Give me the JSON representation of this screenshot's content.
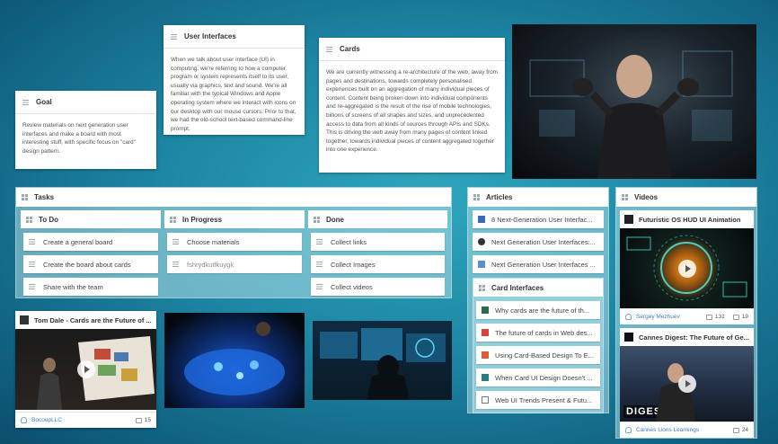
{
  "notes": {
    "goal": {
      "title": "Goal",
      "body": "Review materials on next generation user interfaces and make a board with most interesting stuff, with specific focus on \"card\" design pattern."
    },
    "user_interfaces": {
      "title": "User Interfaces",
      "body": "When we talk about user interface (UI) in computing, we're referring to how a computer program or system represents itself to its user, usually via graphics, text and sound. We're all familiar with the typical Windows and Apple operating system where we interact with icons on our desktop with our mouse cursors. Prior to that, we had the old-school text-based command-line prompt."
    },
    "cards": {
      "title": "Cards",
      "body": "We are currently witnessing a re-architecture of the web, away from pages and destinations, towards completely personalised experiences built on an aggregation of many individual pieces of content. Content being broken down into individual components and re-aggregated is the result of the rise of mobile technologies, billions of screens of all shapes and sizes, and unprecedented access to data from all kinds of sources through APIs and SDKs. This is driving the web away from many pages of content linked together, towards individual pieces of content aggregated together into one experience."
    }
  },
  "tasks": {
    "title": "Tasks",
    "columns": [
      {
        "title": "To Do",
        "items": [
          "Create a general board",
          "Create the board about cards",
          "Share with the team"
        ]
      },
      {
        "title": "In Progress",
        "items": [
          "Choose materials",
          "fshrydkutfkuygk"
        ]
      },
      {
        "title": "Done",
        "items": [
          "Collect links",
          "Collect Images",
          "Collect videos"
        ]
      }
    ]
  },
  "articles": {
    "title": "Articles",
    "items": [
      "8 Next-Generation User Interfac...",
      "Next Generation User Interfaces:...",
      "Next Generation User Interfaces ..."
    ],
    "subgroup_title": "Card Interfaces",
    "subitems": [
      "Why cards are the future of th...",
      "The future of cards in Web des...",
      "Using Card-Based Design To E...",
      "When Card UI Design Doesn't ...",
      "Web UI Trends Present & Futu..."
    ]
  },
  "videos": {
    "title": "Videos",
    "items": [
      {
        "title": "Futuristic OS HUD UI Animation",
        "author": "Sergey Mezhuev",
        "likes": "131",
        "comments": "19"
      },
      {
        "title": "Cannes Digest: The Future of Ge...",
        "author": "Cannes Lions Learnings",
        "likes": "24",
        "thumb_text": "DIGEST"
      }
    ]
  },
  "bottom_video": {
    "title": "Tom Dale - Cards are the Future of ...",
    "author": "BocoupLLC",
    "likes": "15"
  },
  "icons": [
    "lines-icon",
    "grid-icon",
    "play-icon",
    "user-icon",
    "like-icon",
    "comment-icon"
  ],
  "colors": {
    "accent_link": "#3a7fc1",
    "background": "#1d86a3"
  }
}
